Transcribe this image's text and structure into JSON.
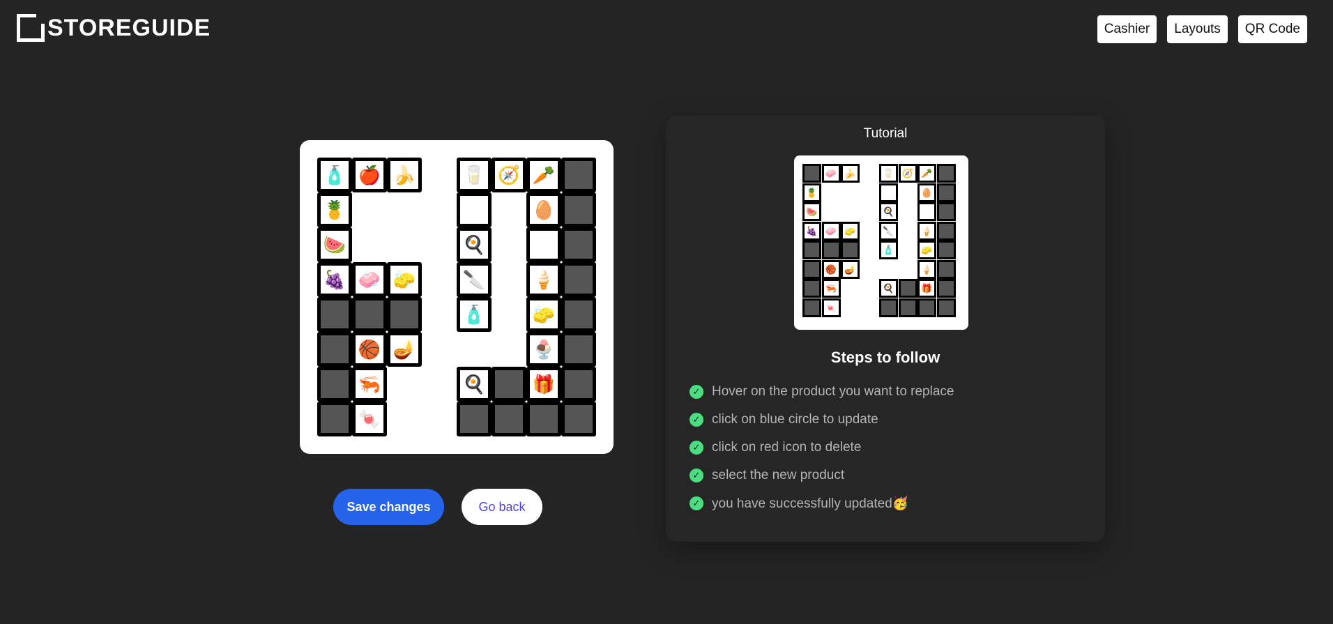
{
  "header": {
    "logo_text": "STOREGUIDE",
    "nav": [
      "Cashier",
      "Layouts",
      "QR Code"
    ]
  },
  "store_grid": {
    "cells": [
      {
        "col": 0,
        "row": 0,
        "icon": "water-bottle",
        "glyph": "🧴"
      },
      {
        "col": 1,
        "row": 0,
        "icon": "apple",
        "glyph": "🍎"
      },
      {
        "col": 2,
        "row": 0,
        "icon": "banana",
        "glyph": "🍌"
      },
      {
        "col": 0,
        "row": 1,
        "icon": "pineapple",
        "glyph": "🍍"
      },
      {
        "col": 0,
        "row": 2,
        "icon": "watermelon",
        "glyph": "🍉"
      },
      {
        "col": 0,
        "row": 3,
        "icon": "grapes",
        "glyph": "🍇"
      },
      {
        "col": 1,
        "row": 3,
        "icon": "green-soap",
        "glyph": "🧼"
      },
      {
        "col": 2,
        "row": 3,
        "icon": "yellow-soap",
        "glyph": "🧽"
      },
      {
        "col": 0,
        "row": 4,
        "icon": "empty",
        "glyph": ""
      },
      {
        "col": 1,
        "row": 4,
        "icon": "empty",
        "glyph": ""
      },
      {
        "col": 2,
        "row": 4,
        "icon": "empty",
        "glyph": ""
      },
      {
        "col": 0,
        "row": 5,
        "icon": "empty",
        "glyph": ""
      },
      {
        "col": 1,
        "row": 5,
        "icon": "basketball",
        "glyph": "🏀"
      },
      {
        "col": 2,
        "row": 5,
        "icon": "lamp",
        "glyph": "🪔"
      },
      {
        "col": 0,
        "row": 6,
        "icon": "empty",
        "glyph": ""
      },
      {
        "col": 1,
        "row": 6,
        "icon": "shrimp",
        "glyph": "🦐"
      },
      {
        "col": 0,
        "row": 7,
        "icon": "empty",
        "glyph": ""
      },
      {
        "col": 1,
        "row": 7,
        "icon": "candy",
        "glyph": "🍬"
      },
      {
        "col": 4,
        "row": 0,
        "icon": "milk-carton",
        "glyph": "🥛"
      },
      {
        "col": 5,
        "row": 0,
        "icon": "compass",
        "glyph": "🧭"
      },
      {
        "col": 6,
        "row": 0,
        "icon": "carrot",
        "glyph": "🥕"
      },
      {
        "col": 7,
        "row": 0,
        "icon": "empty",
        "glyph": ""
      },
      {
        "col": 4,
        "row": 1,
        "icon": "plate",
        "glyph": "🍽"
      },
      {
        "col": 6,
        "row": 1,
        "icon": "egg",
        "glyph": "🥚"
      },
      {
        "col": 7,
        "row": 1,
        "icon": "empty",
        "glyph": ""
      },
      {
        "col": 4,
        "row": 2,
        "icon": "frying-pan",
        "glyph": "🍳"
      },
      {
        "col": 6,
        "row": 2,
        "icon": "pen",
        "glyph": "🖊"
      },
      {
        "col": 7,
        "row": 2,
        "icon": "empty",
        "glyph": ""
      },
      {
        "col": 4,
        "row": 3,
        "icon": "knife",
        "glyph": "🔪"
      },
      {
        "col": 6,
        "row": 3,
        "icon": "ice-cream",
        "glyph": "🍦"
      },
      {
        "col": 7,
        "row": 3,
        "icon": "empty",
        "glyph": ""
      },
      {
        "col": 4,
        "row": 4,
        "icon": "spray-bottle",
        "glyph": "🧴"
      },
      {
        "col": 6,
        "row": 4,
        "icon": "eraser",
        "glyph": "🧽"
      },
      {
        "col": 7,
        "row": 4,
        "icon": "empty",
        "glyph": ""
      },
      {
        "col": 6,
        "row": 5,
        "icon": "ice-cream-cone",
        "glyph": "🍨"
      },
      {
        "col": 7,
        "row": 5,
        "icon": "empty",
        "glyph": ""
      },
      {
        "col": 4,
        "row": 6,
        "icon": "frying-pan",
        "glyph": "🍳"
      },
      {
        "col": 5,
        "row": 6,
        "icon": "empty",
        "glyph": ""
      },
      {
        "col": 6,
        "row": 6,
        "icon": "gift-box",
        "glyph": "🎁"
      },
      {
        "col": 7,
        "row": 6,
        "icon": "empty",
        "glyph": ""
      },
      {
        "col": 4,
        "row": 7,
        "icon": "empty",
        "glyph": ""
      },
      {
        "col": 5,
        "row": 7,
        "icon": "empty",
        "glyph": ""
      },
      {
        "col": 6,
        "row": 7,
        "icon": "empty",
        "glyph": ""
      },
      {
        "col": 7,
        "row": 7,
        "icon": "empty",
        "glyph": ""
      }
    ]
  },
  "actions": {
    "save_label": "Save changes",
    "back_label": "Go back"
  },
  "tutorial": {
    "title": "Tutorial",
    "steps_title": "Steps to follow",
    "steps": [
      "Hover on the product you want to replace",
      "click on blue circle to update",
      "click on red icon to delete",
      "select the new product",
      "you have successfully updated🥳"
    ],
    "mini_cells": [
      {
        "col": 0,
        "row": 0,
        "glyph": ""
      },
      {
        "col": 1,
        "row": 0,
        "glyph": "🧼"
      },
      {
        "col": 2,
        "row": 0,
        "glyph": "🍌"
      },
      {
        "col": 0,
        "row": 1,
        "glyph": "🍍"
      },
      {
        "col": 0,
        "row": 2,
        "glyph": "🍉"
      },
      {
        "col": 0,
        "row": 3,
        "glyph": "🍇"
      },
      {
        "col": 1,
        "row": 3,
        "glyph": "🧼"
      },
      {
        "col": 2,
        "row": 3,
        "glyph": "🧽"
      },
      {
        "col": 0,
        "row": 4,
        "glyph": ""
      },
      {
        "col": 1,
        "row": 4,
        "glyph": ""
      },
      {
        "col": 2,
        "row": 4,
        "glyph": ""
      },
      {
        "col": 0,
        "row": 5,
        "glyph": ""
      },
      {
        "col": 1,
        "row": 5,
        "glyph": "🏀"
      },
      {
        "col": 2,
        "row": 5,
        "glyph": "🪔"
      },
      {
        "col": 0,
        "row": 6,
        "glyph": ""
      },
      {
        "col": 1,
        "row": 6,
        "glyph": "🦐"
      },
      {
        "col": 0,
        "row": 7,
        "glyph": ""
      },
      {
        "col": 1,
        "row": 7,
        "glyph": "🍬"
      },
      {
        "col": 4,
        "row": 0,
        "glyph": "🥛"
      },
      {
        "col": 5,
        "row": 0,
        "glyph": "🧭"
      },
      {
        "col": 6,
        "row": 0,
        "glyph": "🥕"
      },
      {
        "col": 7,
        "row": 0,
        "glyph": ""
      },
      {
        "col": 4,
        "row": 1,
        "glyph": "🍽"
      },
      {
        "col": 6,
        "row": 1,
        "glyph": "🥚"
      },
      {
        "col": 7,
        "row": 1,
        "glyph": ""
      },
      {
        "col": 4,
        "row": 2,
        "glyph": "🍳"
      },
      {
        "col": 6,
        "row": 2,
        "glyph": "🖊"
      },
      {
        "col": 7,
        "row": 2,
        "glyph": ""
      },
      {
        "col": 4,
        "row": 3,
        "glyph": "🔪"
      },
      {
        "col": 6,
        "row": 3,
        "glyph": "🍦"
      },
      {
        "col": 7,
        "row": 3,
        "glyph": ""
      },
      {
        "col": 4,
        "row": 4,
        "glyph": "🧴"
      },
      {
        "col": 6,
        "row": 4,
        "glyph": "🧽"
      },
      {
        "col": 7,
        "row": 4,
        "glyph": ""
      },
      {
        "col": 6,
        "row": 5,
        "glyph": "🍦"
      },
      {
        "col": 7,
        "row": 5,
        "glyph": ""
      },
      {
        "col": 4,
        "row": 6,
        "glyph": "🍳"
      },
      {
        "col": 5,
        "row": 6,
        "glyph": ""
      },
      {
        "col": 6,
        "row": 6,
        "glyph": "🎁"
      },
      {
        "col": 7,
        "row": 6,
        "glyph": ""
      },
      {
        "col": 4,
        "row": 7,
        "glyph": ""
      },
      {
        "col": 5,
        "row": 7,
        "glyph": ""
      },
      {
        "col": 6,
        "row": 7,
        "glyph": ""
      },
      {
        "col": 7,
        "row": 7,
        "glyph": ""
      }
    ]
  },
  "colors": {
    "background": "#242424",
    "primary": "#2563eb",
    "check": "#4ade80",
    "empty_cell": "#555555"
  }
}
